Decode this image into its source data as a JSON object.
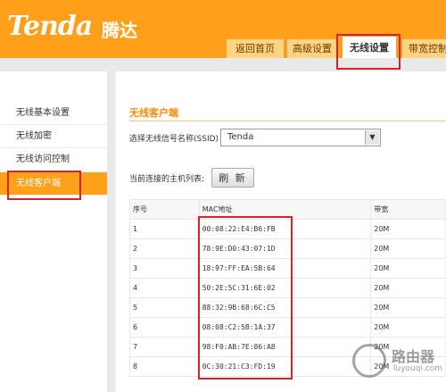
{
  "header": {
    "logo": "Tenda",
    "logo_cn": "腾达",
    "tabs": [
      {
        "label": "返回首页"
      },
      {
        "label": "高级设置"
      },
      {
        "label": "无线设置"
      },
      {
        "label": "带宽控制"
      }
    ]
  },
  "sidebar": {
    "items": [
      {
        "label": "无线基本设置"
      },
      {
        "label": "无线加密"
      },
      {
        "label": "无线访问控制"
      },
      {
        "label": "无线客户端"
      }
    ]
  },
  "main": {
    "section_title": "无线客户端",
    "ssid_label": "选择无线信号名称(SSID)",
    "ssid_value": "Tenda",
    "host_list_label": "当前连接的主机列表:",
    "refresh_label": "刷 新",
    "table": {
      "headers": [
        "序号",
        "MAC地址",
        "带宽"
      ],
      "rows": [
        {
          "idx": "1",
          "mac": "00:08:22:E4:B6:FB",
          "bw": "20M"
        },
        {
          "idx": "2",
          "mac": "78:9E:D0:43:07:1D",
          "bw": "20M"
        },
        {
          "idx": "3",
          "mac": "18:97:FF:EA:5B:64",
          "bw": "20M"
        },
        {
          "idx": "4",
          "mac": "50:2E:5C:31:6E:02",
          "bw": "20M"
        },
        {
          "idx": "5",
          "mac": "88:32:9B:68:6C:C5",
          "bw": "20M"
        },
        {
          "idx": "6",
          "mac": "08:08:C2:5B:1A:37",
          "bw": "20M"
        },
        {
          "idx": "7",
          "mac": "98:F0:AB:7E:86:A8",
          "bw": "20M"
        },
        {
          "idx": "8",
          "mac": "0C:30:21:C3:FD:19",
          "bw": "20M"
        }
      ]
    }
  },
  "watermark": {
    "text": "路由器",
    "sub": "luyouqi.com"
  },
  "colors": {
    "brand_orange": "#ff9f1a",
    "highlight_red": "#d8232a"
  }
}
